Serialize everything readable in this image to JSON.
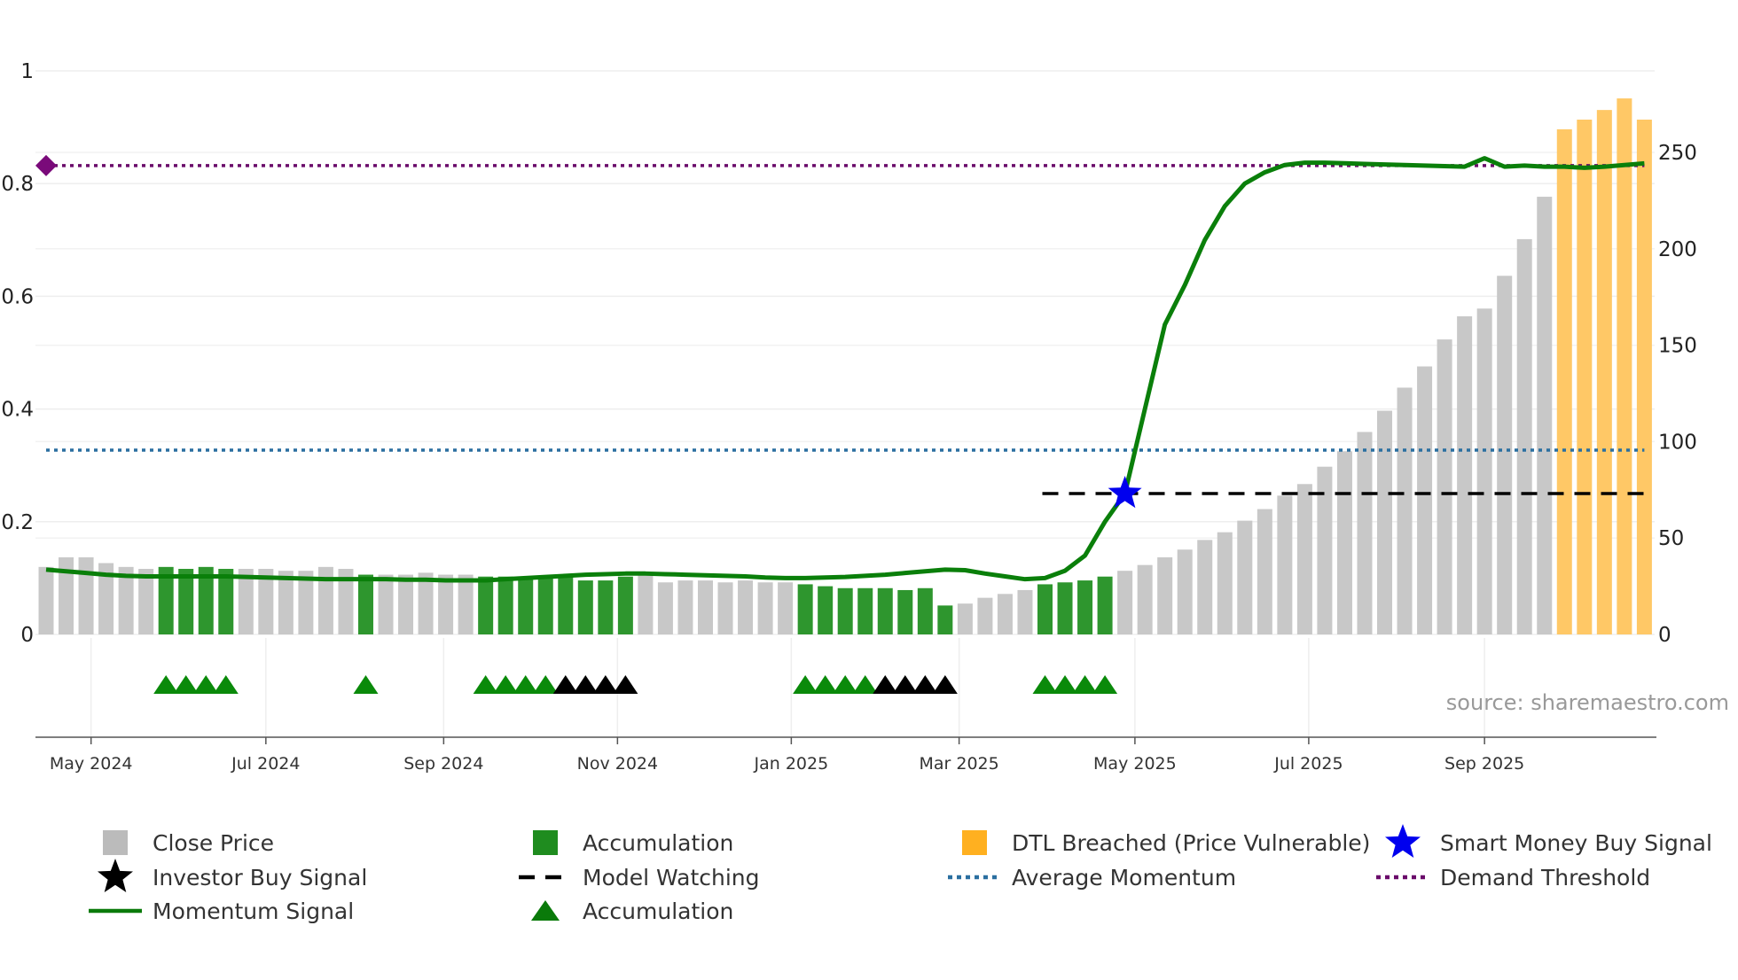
{
  "chart_data": {
    "type": "bar",
    "title": "",
    "source_text": "source: sharemaestro.com",
    "left_axis": {
      "ylim": [
        0,
        1
      ],
      "ticks": [
        0,
        0.2,
        0.4,
        0.6,
        0.8,
        1
      ],
      "tick_labels": [
        "0",
        "0.2",
        "0.4",
        "0.6",
        "0.8",
        "1"
      ]
    },
    "right_axis": {
      "ylim": [
        0,
        285
      ],
      "ticks": [
        0,
        50,
        100,
        150,
        200,
        250
      ],
      "tick_labels": [
        "0",
        "50",
        "100",
        "150",
        "200",
        "250"
      ]
    },
    "x_ticks": [
      {
        "label": "May 2024",
        "index": 2.25
      },
      {
        "label": "Jul 2024",
        "index": 11.0
      },
      {
        "label": "Sep 2024",
        "index": 19.9
      },
      {
        "label": "Nov 2024",
        "index": 28.6
      },
      {
        "label": "Jan 2025",
        "index": 37.3
      },
      {
        "label": "Mar 2025",
        "index": 45.7
      },
      {
        "label": "May 2025",
        "index": 54.5
      },
      {
        "label": "Jul 2025",
        "index": 63.2
      },
      {
        "label": "Sep 2025",
        "index": 72.0
      }
    ],
    "close_price": [
      35,
      40,
      40,
      37,
      35,
      34,
      35,
      34,
      35,
      34,
      34,
      34,
      33,
      33,
      35,
      34,
      31,
      31,
      31,
      32,
      31,
      31,
      30,
      30,
      30,
      30,
      30,
      28,
      28,
      30,
      31,
      27,
      28,
      28,
      27,
      28,
      27,
      27,
      26,
      25,
      24,
      24,
      24,
      23,
      24,
      15,
      16,
      19,
      21,
      23,
      26,
      27,
      28,
      30,
      33,
      36,
      40,
      44,
      49,
      53,
      59,
      65,
      72,
      78,
      87,
      95,
      105,
      116,
      128,
      139,
      153,
      165,
      169,
      186,
      205,
      227,
      262,
      267,
      272,
      278,
      267
    ],
    "bar_state": [
      "c",
      "c",
      "c",
      "c",
      "c",
      "c",
      "a",
      "a",
      "a",
      "a",
      "c",
      "c",
      "c",
      "c",
      "c",
      "c",
      "a",
      "c",
      "c",
      "c",
      "c",
      "c",
      "a",
      "a",
      "a",
      "a",
      "a",
      "a",
      "a",
      "a",
      "c",
      "c",
      "c",
      "c",
      "c",
      "c",
      "c",
      "c",
      "a",
      "a",
      "a",
      "a",
      "a",
      "a",
      "a",
      "a",
      "c",
      "c",
      "c",
      "c",
      "a",
      "a",
      "a",
      "a",
      "c",
      "c",
      "c",
      "c",
      "c",
      "c",
      "c",
      "c",
      "c",
      "c",
      "c",
      "c",
      "c",
      "c",
      "c",
      "c",
      "c",
      "c",
      "c",
      "c",
      "c",
      "c",
      "d",
      "d",
      "d",
      "d",
      "d"
    ],
    "momentum": [
      0.115,
      0.112,
      0.109,
      0.106,
      0.104,
      0.103,
      0.103,
      0.103,
      0.103,
      0.103,
      0.102,
      0.101,
      0.1,
      0.099,
      0.098,
      0.098,
      0.098,
      0.098,
      0.097,
      0.097,
      0.096,
      0.096,
      0.096,
      0.098,
      0.1,
      0.102,
      0.104,
      0.106,
      0.107,
      0.108,
      0.108,
      0.107,
      0.106,
      0.105,
      0.104,
      0.103,
      0.101,
      0.1,
      0.1,
      0.101,
      0.102,
      0.104,
      0.106,
      0.109,
      0.112,
      0.115,
      0.114,
      0.108,
      0.103,
      0.098,
      0.1,
      0.113,
      0.14,
      0.2,
      0.25,
      0.4,
      0.55,
      0.62,
      0.7,
      0.76,
      0.8,
      0.82,
      0.833,
      0.837,
      0.837,
      0.836,
      0.835,
      0.834,
      0.833,
      0.832,
      0.831,
      0.83,
      0.845,
      0.83,
      0.832,
      0.83,
      0.83,
      0.828,
      0.83,
      0.833,
      0.836
    ],
    "average_momentum": 0.327,
    "demand_threshold": 0.832,
    "model_watching": {
      "value": 0.25,
      "start_index": 50
    },
    "smart_money_buy_signal": {
      "index": 54,
      "value": 0.25
    },
    "accumulation_markers": [
      6,
      7,
      8,
      9,
      16,
      22,
      23,
      24,
      25,
      38,
      39,
      40,
      41,
      50,
      51,
      52,
      53
    ],
    "investor_buy_markers": [
      26,
      27,
      28,
      29,
      42,
      43,
      44,
      45
    ],
    "legend": [
      {
        "label": "Close Price",
        "kind": "bar",
        "color": "#bbbbbb"
      },
      {
        "label": "Accumulation",
        "kind": "bar",
        "color": "#1f8c1f"
      },
      {
        "label": "DTL Breached (Price Vulnerable)",
        "kind": "bar",
        "color": "#ffb020"
      },
      {
        "label": "Smart Money Buy Signal",
        "kind": "star",
        "color": "#0000ee"
      },
      {
        "label": "Investor Buy Signal",
        "kind": "star",
        "color": "#000000"
      },
      {
        "label": "Model Watching",
        "kind": "dash",
        "color": "#000000"
      },
      {
        "label": "Average Momentum",
        "kind": "dot",
        "color": "#2a6fa0"
      },
      {
        "label": "Demand Threshold",
        "kind": "dot",
        "color": "#6a0a6a"
      },
      {
        "label": "Momentum Signal",
        "kind": "line",
        "color": "#0a7a0a"
      },
      {
        "label": "Accumulation",
        "kind": "triangle",
        "color": "#0a7a0a"
      }
    ],
    "colors": {
      "close": "#c8c8c8",
      "accum": "#2e962e",
      "dtl": "#ffc866",
      "momentum": "#0a7f0a",
      "avg": "#2a6fa0",
      "threshold": "#6a0a6a",
      "diamond": "#7a0a7a"
    }
  }
}
